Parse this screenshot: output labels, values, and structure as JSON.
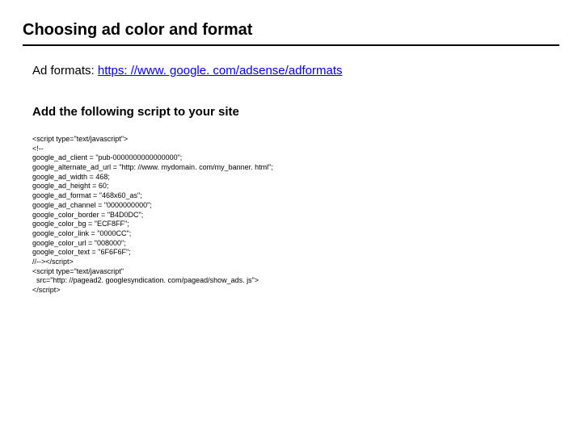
{
  "title": "Choosing ad color and format",
  "adformats_label": "Ad formats: ",
  "adformats_url": "https: //www. google. com/adsense/adformats",
  "add_script_heading": "Add the following script to your site",
  "code_lines": [
    "<script type=\"text/javascript\">",
    "<!--",
    "google_ad_client = \"pub-0000000000000000\";",
    "google_alternate_ad_url = \"http: //www. mydomain. com/my_banner. html\";",
    "google_ad_width = 468;",
    "google_ad_height = 60;",
    "google_ad_format = \"468x60_as\";",
    "google_ad_channel = \"0000000000\";",
    "google_color_border = \"B4D0DC\";",
    "google_color_bg = \"ECF8FF\";",
    "google_color_link = \"0000CC\";",
    "google_color_url = \"008000\";",
    "google_color_text = \"6F6F6F\";",
    "//--></script>",
    "<script type=\"text/javascript\"",
    "  src=\"http: //pagead2. googlesyndication. com/pagead/show_ads. js\">",
    "</script>"
  ]
}
